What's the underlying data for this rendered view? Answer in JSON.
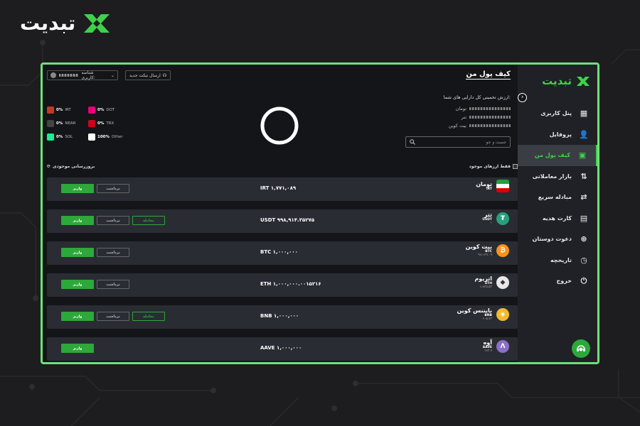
{
  "brand": {
    "name": "تبدیت",
    "accent": "#3fd14a"
  },
  "sidebar": {
    "logo_name": "تبدیت",
    "items": [
      {
        "label": "پنل کاربری",
        "icon": "grid-icon"
      },
      {
        "label": "پروفایل",
        "icon": "user-icon"
      },
      {
        "label": "کیف پول من",
        "icon": "wallet-icon",
        "active": true
      },
      {
        "label": "بازار معاملاتی",
        "icon": "market-icon"
      },
      {
        "label": "مبادله سریع",
        "icon": "swap-icon"
      },
      {
        "label": "کارت هدیه",
        "icon": "gift-card-icon"
      },
      {
        "label": "دعوت دوستان",
        "icon": "invite-icon"
      },
      {
        "label": "تاریخچه",
        "icon": "clock-icon"
      },
      {
        "label": "خروج",
        "icon": "power-icon"
      }
    ]
  },
  "header": {
    "title": "کیف پول من",
    "user_label": "شناسه کاربری:",
    "ticket_label": "ارسال تیکت جدید"
  },
  "summary": {
    "label": "ارزش تخمینی کل دارایی های شما:",
    "units": [
      "تومان",
      "تتر",
      "بیت کوین"
    ],
    "search_placeholder": "جست و جو"
  },
  "legend": [
    {
      "pct": "0%",
      "sym": "IRT",
      "color": "#c0392b"
    },
    {
      "pct": "0%",
      "sym": "DOT",
      "color": "#e6007a"
    },
    {
      "pct": "0%",
      "sym": "NEAR",
      "color": "#444444"
    },
    {
      "pct": "0%",
      "sym": "TRX",
      "color": "#d0021b"
    },
    {
      "pct": "0%",
      "sym": "SOL",
      "color": "#14f195"
    },
    {
      "pct": "100%",
      "sym": "Other",
      "color": "#ffffff"
    }
  ],
  "toolbar": {
    "refresh_label": "بروزرسانی موجودی",
    "only_assets_label": "فقط ارزهای موجود"
  },
  "buttons": {
    "deposit": "واریز",
    "withdraw": "برداشت",
    "trade": "معامله"
  },
  "assets": [
    {
      "fa": "تومان",
      "sym": "IRT",
      "price": "",
      "balance": "IRT ۱,۷۷۱,۰۸۹",
      "color": "#ffffff",
      "glyph": "☰",
      "withdraw": true,
      "trade": false
    },
    {
      "fa": "تتر",
      "sym": "USDT",
      "price": "۱",
      "balance": "USDT ۹۹۸,۹۱۴.۳۵۲۷۵",
      "color": "#26a17b",
      "glyph": "₮",
      "withdraw": true,
      "trade": true
    },
    {
      "fa": "بیت کوین",
      "sym": "BTC",
      "price": "۹۶,۱۶۹.۰۹",
      "balance": "BTC ۱,۰۰۰,۰۰۰",
      "color": "#f7931a",
      "glyph": "₿",
      "withdraw": true,
      "trade": false
    },
    {
      "fa": "اتریوم",
      "sym": "ETH",
      "price": "۱,۸۳۵.۵۳",
      "balance": "ETH ۱,۰۰۰,۰۰۰.۰۰۱۵۲۱۶",
      "color": "#e8e8e8",
      "glyph": "◆",
      "withdraw": true,
      "trade": false
    },
    {
      "fa": "بایننس کوین",
      "sym": "BNB",
      "price": "۶۰۵.۷۳",
      "balance": "BNB ۱,۰۰۰,۰۰۰",
      "color": "#f3ba2f",
      "glyph": "◈",
      "withdraw": true,
      "trade": true
    },
    {
      "fa": "آوه",
      "sym": "AAVE",
      "price": "۱۷۳.۷",
      "balance": "AAVE ۱,۰۰۰,۰۰۰",
      "color": "#8b6fc6",
      "glyph": "Λ",
      "withdraw": false,
      "trade": false
    }
  ]
}
